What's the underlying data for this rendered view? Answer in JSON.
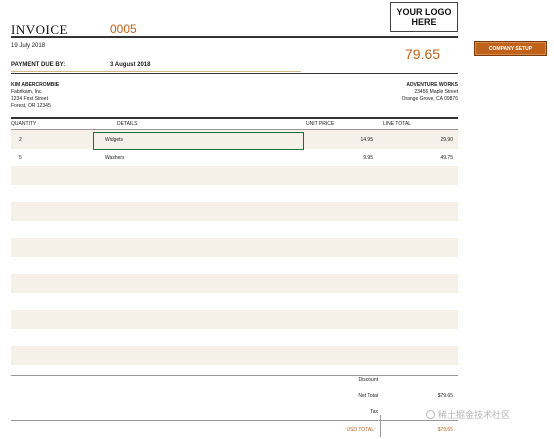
{
  "invoice": {
    "title": "INVOICE",
    "number": "0005",
    "date": "19 July 2018",
    "total": "79.65"
  },
  "logo": {
    "text": "YOUR LOGO\nHERE"
  },
  "buttons": {
    "company_setup": "COMPANY SETUP"
  },
  "payment": {
    "label": "PAYMENT DUE BY:",
    "value": "3 August 2018"
  },
  "bill_to": {
    "name": "KIM ABERCROMBIE",
    "company": "Fabrikam, Inc.",
    "street": "1234 First Street",
    "city": "Forest, OR 12345"
  },
  "from": {
    "name": "ADVENTURE WORKS",
    "street": "23456 Maple Street",
    "city": "Orange Grove, CA 09876"
  },
  "table": {
    "headers": {
      "quantity": "QUANTITY",
      "details": "DETAILS",
      "unit_price": "UNIT PRICE",
      "line_total": "LINE TOTAL"
    },
    "rows": [
      {
        "quantity": "2",
        "details": "Widgets",
        "unit_price": "14.95",
        "line_total": "29.90"
      },
      {
        "quantity": "5",
        "details": "Washers",
        "unit_price": "9.95",
        "line_total": "49.75"
      }
    ]
  },
  "summary": {
    "discount_label": "Discount",
    "net_total_label": "Net Total",
    "net_total_value": "$79.65",
    "tax_label": "Tax",
    "usd_total_label": "USD TOTAL",
    "usd_total_value": "$79.65"
  },
  "watermark": {
    "text": "稀土掘金技术社区"
  },
  "colors": {
    "accent": "#c0621a",
    "row_shade": "#f5f1e8",
    "selection": "#1e6e42"
  }
}
